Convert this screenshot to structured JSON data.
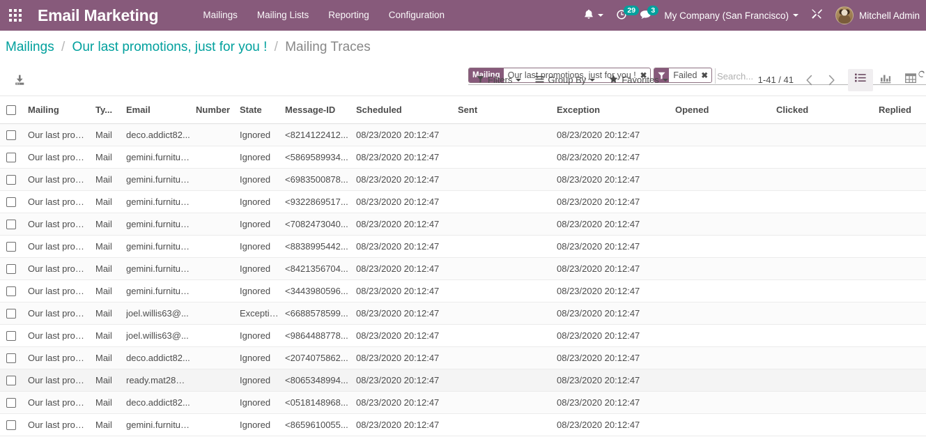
{
  "navbar": {
    "apps_icon": "apps-grid-icon",
    "brand": "Email Marketing",
    "menu": [
      {
        "label": "Mailings"
      },
      {
        "label": "Mailing Lists"
      },
      {
        "label": "Reporting"
      },
      {
        "label": "Configuration"
      }
    ],
    "activities_icon": "bell-icon",
    "clock_icon": "clock-icon",
    "clock_badge": "29",
    "messages_icon": "chat-icon",
    "messages_badge": "3",
    "company": "My Company (San Francisco)",
    "debug_icon": "wrench-icon",
    "avatar_icon": "user-avatar",
    "user": "Mitchell Admin",
    "bg_color": "#875A7B",
    "badge_color": "#00A09D"
  },
  "breadcrumb": {
    "root": "Mailings",
    "parent": "Our last promotions, just for you !",
    "current": "Mailing Traces",
    "separator": "/",
    "link_color": "#00A09D"
  },
  "search": {
    "facets": [
      {
        "label": "Mailing",
        "icon": "",
        "value": "Our last promotions, just for you !",
        "remove": "✖"
      },
      {
        "label": "",
        "icon": "filter-icon",
        "value": "Failed",
        "remove": "✖"
      }
    ],
    "placeholder": "Search...",
    "value": "",
    "toggle_icon": "search-toggle-icon"
  },
  "toolbar": {
    "export_icon": "download-icon",
    "filters_label": "Filters",
    "filters_icon": "filter-icon",
    "groupby_label": "Group By",
    "groupby_icon": "list-lines-icon",
    "favorites_label": "Favorites",
    "favorites_icon": "star-icon",
    "pager": "1-41 / 41",
    "prev_icon": "chevron-left-icon",
    "next_icon": "chevron-right-icon",
    "views": [
      {
        "name": "list-view",
        "icon": "list-icon",
        "active": true
      },
      {
        "name": "graph-view",
        "icon": "bar-chart-icon",
        "active": false
      },
      {
        "name": "pivot-view",
        "icon": "pivot-table-icon",
        "active": false
      }
    ]
  },
  "table": {
    "columns": [
      "Mailing",
      "Ty...",
      "Email",
      "Number",
      "State",
      "Message-ID",
      "Scheduled",
      "Sent",
      "Exception",
      "Opened",
      "Clicked",
      "Replied"
    ],
    "rows": [
      {
        "mailing": "Our last promo...",
        "type": "Mail",
        "email": "deco.addict82...",
        "number": "",
        "state": "Ignored",
        "message_id": "<8214122412...",
        "scheduled": "08/23/2020 20:12:47",
        "sent": "",
        "exception": "08/23/2020 20:12:47",
        "opened": "",
        "clicked": "",
        "replied": ""
      },
      {
        "mailing": "Our last promo...",
        "type": "Mail",
        "email": "gemini.furnitur...",
        "number": "",
        "state": "Ignored",
        "message_id": "<5869589934...",
        "scheduled": "08/23/2020 20:12:47",
        "sent": "",
        "exception": "08/23/2020 20:12:47",
        "opened": "",
        "clicked": "",
        "replied": ""
      },
      {
        "mailing": "Our last promo...",
        "type": "Mail",
        "email": "gemini.furnitur...",
        "number": "",
        "state": "Ignored",
        "message_id": "<6983500878...",
        "scheduled": "08/23/2020 20:12:47",
        "sent": "",
        "exception": "08/23/2020 20:12:47",
        "opened": "",
        "clicked": "",
        "replied": ""
      },
      {
        "mailing": "Our last promo...",
        "type": "Mail",
        "email": "gemini.furnitur...",
        "number": "",
        "state": "Ignored",
        "message_id": "<9322869517...",
        "scheduled": "08/23/2020 20:12:47",
        "sent": "",
        "exception": "08/23/2020 20:12:47",
        "opened": "",
        "clicked": "",
        "replied": ""
      },
      {
        "mailing": "Our last promo...",
        "type": "Mail",
        "email": "gemini.furnitur...",
        "number": "",
        "state": "Ignored",
        "message_id": "<7082473040...",
        "scheduled": "08/23/2020 20:12:47",
        "sent": "",
        "exception": "08/23/2020 20:12:47",
        "opened": "",
        "clicked": "",
        "replied": ""
      },
      {
        "mailing": "Our last promo...",
        "type": "Mail",
        "email": "gemini.furnitur...",
        "number": "",
        "state": "Ignored",
        "message_id": "<8838995442...",
        "scheduled": "08/23/2020 20:12:47",
        "sent": "",
        "exception": "08/23/2020 20:12:47",
        "opened": "",
        "clicked": "",
        "replied": ""
      },
      {
        "mailing": "Our last promo...",
        "type": "Mail",
        "email": "gemini.furnitur...",
        "number": "",
        "state": "Ignored",
        "message_id": "<8421356704...",
        "scheduled": "08/23/2020 20:12:47",
        "sent": "",
        "exception": "08/23/2020 20:12:47",
        "opened": "",
        "clicked": "",
        "replied": ""
      },
      {
        "mailing": "Our last promo...",
        "type": "Mail",
        "email": "gemini.furnitur...",
        "number": "",
        "state": "Ignored",
        "message_id": "<3443980596...",
        "scheduled": "08/23/2020 20:12:47",
        "sent": "",
        "exception": "08/23/2020 20:12:47",
        "opened": "",
        "clicked": "",
        "replied": ""
      },
      {
        "mailing": "Our last promo...",
        "type": "Mail",
        "email": "joel.willis63@...",
        "number": "",
        "state": "Exception",
        "message_id": "<6688578599...",
        "scheduled": "08/23/2020 20:12:47",
        "sent": "",
        "exception": "08/23/2020 20:12:47",
        "opened": "",
        "clicked": "",
        "replied": ""
      },
      {
        "mailing": "Our last promo...",
        "type": "Mail",
        "email": "joel.willis63@...",
        "number": "",
        "state": "Ignored",
        "message_id": "<9864488778...",
        "scheduled": "08/23/2020 20:12:47",
        "sent": "",
        "exception": "08/23/2020 20:12:47",
        "opened": "",
        "clicked": "",
        "replied": ""
      },
      {
        "mailing": "Our last promo...",
        "type": "Mail",
        "email": "deco.addict82...",
        "number": "",
        "state": "Ignored",
        "message_id": "<2074075862...",
        "scheduled": "08/23/2020 20:12:47",
        "sent": "",
        "exception": "08/23/2020 20:12:47",
        "opened": "",
        "clicked": "",
        "replied": ""
      },
      {
        "mailing": "Our last promo...",
        "type": "Mail",
        "email": "ready.mat28@...",
        "number": "",
        "state": "Ignored",
        "message_id": "<8065348994...",
        "scheduled": "08/23/2020 20:12:47",
        "sent": "",
        "exception": "08/23/2020 20:12:47",
        "opened": "",
        "clicked": "",
        "replied": ""
      },
      {
        "mailing": "Our last promo...",
        "type": "Mail",
        "email": "deco.addict82...",
        "number": "",
        "state": "Ignored",
        "message_id": "<0518148968...",
        "scheduled": "08/23/2020 20:12:47",
        "sent": "",
        "exception": "08/23/2020 20:12:47",
        "opened": "",
        "clicked": "",
        "replied": ""
      },
      {
        "mailing": "Our last promo...",
        "type": "Mail",
        "email": "gemini.furnitur...",
        "number": "",
        "state": "Ignored",
        "message_id": "<8659610055...",
        "scheduled": "08/23/2020 20:12:47",
        "sent": "",
        "exception": "08/23/2020 20:12:47",
        "opened": "",
        "clicked": "",
        "replied": ""
      }
    ]
  }
}
